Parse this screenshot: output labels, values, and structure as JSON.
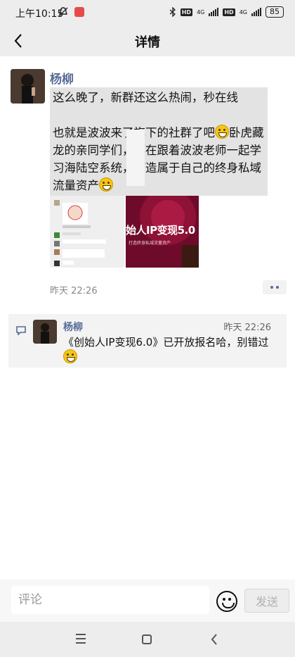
{
  "status_bar": {
    "time": "上午10:15",
    "network_label": "4G",
    "hd_label": "HD",
    "battery": "85"
  },
  "header": {
    "title": "详情"
  },
  "post": {
    "author": "杨柳",
    "paragraph1": "这么晚了，新群还这么热闹，秒在线",
    "paragraph2a": "也就是波波来了旗下的社群了吧",
    "paragraph2b": "卧虎藏龙的亲同学们，都在跟着波波老师一起学习海陆空系统，打造属于自己的终身私域流量资产",
    "image2_title": "始人IP变现5.0",
    "image2_sub": "打造终身私域流量资产",
    "time": "昨天 22:26"
  },
  "comment": {
    "author": "杨柳",
    "time": "昨天 22:26",
    "text": "《创始人IP变现6.0》已开放报名哈，别错过"
  },
  "input_bar": {
    "placeholder": "评论",
    "send_label": "发送"
  },
  "colors": {
    "author_link": "#576b95",
    "selection_bg": "#e3e3e3"
  }
}
